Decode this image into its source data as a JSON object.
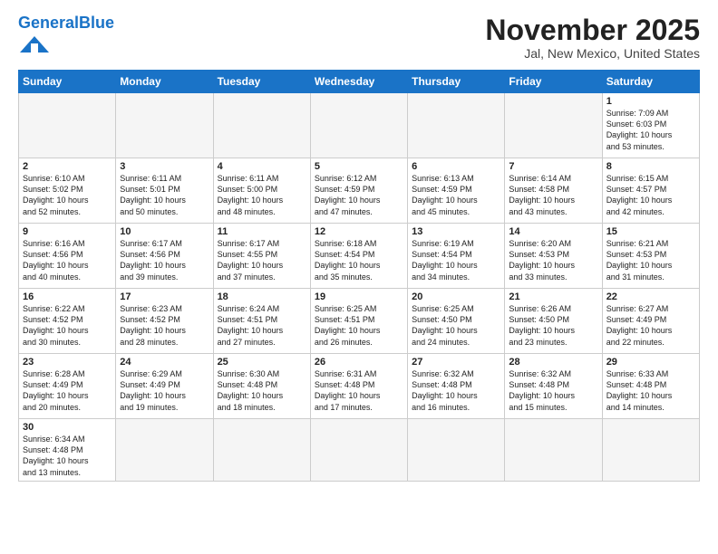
{
  "header": {
    "logo_general": "General",
    "logo_blue": "Blue",
    "title": "November 2025",
    "subtitle": "Jal, New Mexico, United States"
  },
  "weekdays": [
    "Sunday",
    "Monday",
    "Tuesday",
    "Wednesday",
    "Thursday",
    "Friday",
    "Saturday"
  ],
  "weeks": [
    [
      {
        "day": "",
        "info": "",
        "empty": true
      },
      {
        "day": "",
        "info": "",
        "empty": true
      },
      {
        "day": "",
        "info": "",
        "empty": true
      },
      {
        "day": "",
        "info": "",
        "empty": true
      },
      {
        "day": "",
        "info": "",
        "empty": true
      },
      {
        "day": "",
        "info": "",
        "empty": true
      },
      {
        "day": "1",
        "info": "Sunrise: 7:09 AM\nSunset: 6:03 PM\nDaylight: 10 hours\nand 53 minutes."
      }
    ],
    [
      {
        "day": "2",
        "info": "Sunrise: 6:10 AM\nSunset: 5:02 PM\nDaylight: 10 hours\nand 52 minutes."
      },
      {
        "day": "3",
        "info": "Sunrise: 6:11 AM\nSunset: 5:01 PM\nDaylight: 10 hours\nand 50 minutes."
      },
      {
        "day": "4",
        "info": "Sunrise: 6:11 AM\nSunset: 5:00 PM\nDaylight: 10 hours\nand 48 minutes."
      },
      {
        "day": "5",
        "info": "Sunrise: 6:12 AM\nSunset: 4:59 PM\nDaylight: 10 hours\nand 47 minutes."
      },
      {
        "day": "6",
        "info": "Sunrise: 6:13 AM\nSunset: 4:59 PM\nDaylight: 10 hours\nand 45 minutes."
      },
      {
        "day": "7",
        "info": "Sunrise: 6:14 AM\nSunset: 4:58 PM\nDaylight: 10 hours\nand 43 minutes."
      },
      {
        "day": "8",
        "info": "Sunrise: 6:15 AM\nSunset: 4:57 PM\nDaylight: 10 hours\nand 42 minutes."
      }
    ],
    [
      {
        "day": "9",
        "info": "Sunrise: 6:16 AM\nSunset: 4:56 PM\nDaylight: 10 hours\nand 40 minutes."
      },
      {
        "day": "10",
        "info": "Sunrise: 6:17 AM\nSunset: 4:56 PM\nDaylight: 10 hours\nand 39 minutes."
      },
      {
        "day": "11",
        "info": "Sunrise: 6:17 AM\nSunset: 4:55 PM\nDaylight: 10 hours\nand 37 minutes."
      },
      {
        "day": "12",
        "info": "Sunrise: 6:18 AM\nSunset: 4:54 PM\nDaylight: 10 hours\nand 35 minutes."
      },
      {
        "day": "13",
        "info": "Sunrise: 6:19 AM\nSunset: 4:54 PM\nDaylight: 10 hours\nand 34 minutes."
      },
      {
        "day": "14",
        "info": "Sunrise: 6:20 AM\nSunset: 4:53 PM\nDaylight: 10 hours\nand 33 minutes."
      },
      {
        "day": "15",
        "info": "Sunrise: 6:21 AM\nSunset: 4:53 PM\nDaylight: 10 hours\nand 31 minutes."
      }
    ],
    [
      {
        "day": "16",
        "info": "Sunrise: 6:22 AM\nSunset: 4:52 PM\nDaylight: 10 hours\nand 30 minutes."
      },
      {
        "day": "17",
        "info": "Sunrise: 6:23 AM\nSunset: 4:52 PM\nDaylight: 10 hours\nand 28 minutes."
      },
      {
        "day": "18",
        "info": "Sunrise: 6:24 AM\nSunset: 4:51 PM\nDaylight: 10 hours\nand 27 minutes."
      },
      {
        "day": "19",
        "info": "Sunrise: 6:25 AM\nSunset: 4:51 PM\nDaylight: 10 hours\nand 26 minutes."
      },
      {
        "day": "20",
        "info": "Sunrise: 6:25 AM\nSunset: 4:50 PM\nDaylight: 10 hours\nand 24 minutes."
      },
      {
        "day": "21",
        "info": "Sunrise: 6:26 AM\nSunset: 4:50 PM\nDaylight: 10 hours\nand 23 minutes."
      },
      {
        "day": "22",
        "info": "Sunrise: 6:27 AM\nSunset: 4:49 PM\nDaylight: 10 hours\nand 22 minutes."
      }
    ],
    [
      {
        "day": "23",
        "info": "Sunrise: 6:28 AM\nSunset: 4:49 PM\nDaylight: 10 hours\nand 20 minutes."
      },
      {
        "day": "24",
        "info": "Sunrise: 6:29 AM\nSunset: 4:49 PM\nDaylight: 10 hours\nand 19 minutes."
      },
      {
        "day": "25",
        "info": "Sunrise: 6:30 AM\nSunset: 4:48 PM\nDaylight: 10 hours\nand 18 minutes."
      },
      {
        "day": "26",
        "info": "Sunrise: 6:31 AM\nSunset: 4:48 PM\nDaylight: 10 hours\nand 17 minutes."
      },
      {
        "day": "27",
        "info": "Sunrise: 6:32 AM\nSunset: 4:48 PM\nDaylight: 10 hours\nand 16 minutes."
      },
      {
        "day": "28",
        "info": "Sunrise: 6:32 AM\nSunset: 4:48 PM\nDaylight: 10 hours\nand 15 minutes."
      },
      {
        "day": "29",
        "info": "Sunrise: 6:33 AM\nSunset: 4:48 PM\nDaylight: 10 hours\nand 14 minutes."
      }
    ],
    [
      {
        "day": "30",
        "info": "Sunrise: 6:34 AM\nSunset: 4:48 PM\nDaylight: 10 hours\nand 13 minutes."
      },
      {
        "day": "",
        "info": "",
        "empty": true
      },
      {
        "day": "",
        "info": "",
        "empty": true
      },
      {
        "day": "",
        "info": "",
        "empty": true
      },
      {
        "day": "",
        "info": "",
        "empty": true
      },
      {
        "day": "",
        "info": "",
        "empty": true
      },
      {
        "day": "",
        "info": "",
        "empty": true
      }
    ]
  ]
}
